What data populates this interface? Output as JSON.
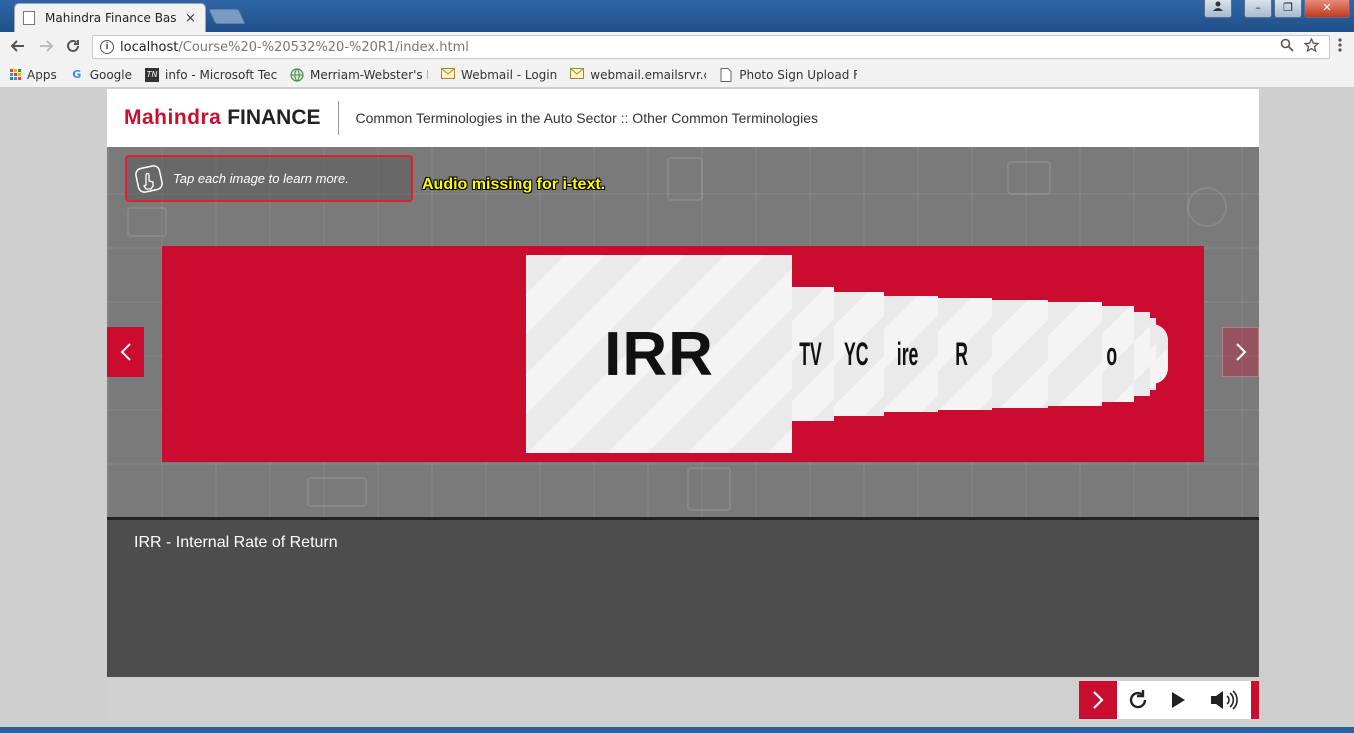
{
  "browser": {
    "tab_title": "Mahindra Finance Basics",
    "tab_close": "×",
    "url_host": "localhost",
    "url_path": "/Course%20-%20532%20-%20R1/index.html",
    "window_buttons": {
      "minimize": "–",
      "maximize": "❐",
      "close": "✕"
    }
  },
  "bookmarks": [
    {
      "label": "Apps"
    },
    {
      "label": "Google"
    },
    {
      "label": "info - Microsoft Tech"
    },
    {
      "label": "Merriam-Webster's Le"
    },
    {
      "label": "Webmail - Login"
    },
    {
      "label": "webmail.emailsrvr.cor"
    },
    {
      "label": "Photo Sign Upload Fo"
    }
  ],
  "header": {
    "logo_brand": "Mahindra",
    "logo_sub": "FINANCE",
    "title": "Common Terminologies in the Auto Sector :: Other Common Terminologies"
  },
  "stage": {
    "instruction": "Tap each image to learn more.",
    "audio_note": "Audio missing for i-text."
  },
  "carousel": {
    "active_card": "IRR",
    "side_cards": [
      "TV",
      "YC",
      "ire",
      "R",
      "",
      "",
      "o",
      "",
      "",
      ""
    ]
  },
  "info": {
    "text": "IRR - Internal Rate of Return"
  },
  "icons": {
    "back": "back-arrow-icon",
    "forward": "forward-arrow-icon",
    "reload": "reload-icon",
    "zoom": "magnifier-icon",
    "star": "star-icon",
    "menu": "menu-dots-icon",
    "prev": "chevron-left-icon",
    "next": "chevron-right-icon",
    "replay": "replay-icon",
    "play": "play-icon",
    "audio": "speaker-icon"
  },
  "colors": {
    "brand_red": "#c90c2f",
    "audio_note": "#ffff00"
  }
}
